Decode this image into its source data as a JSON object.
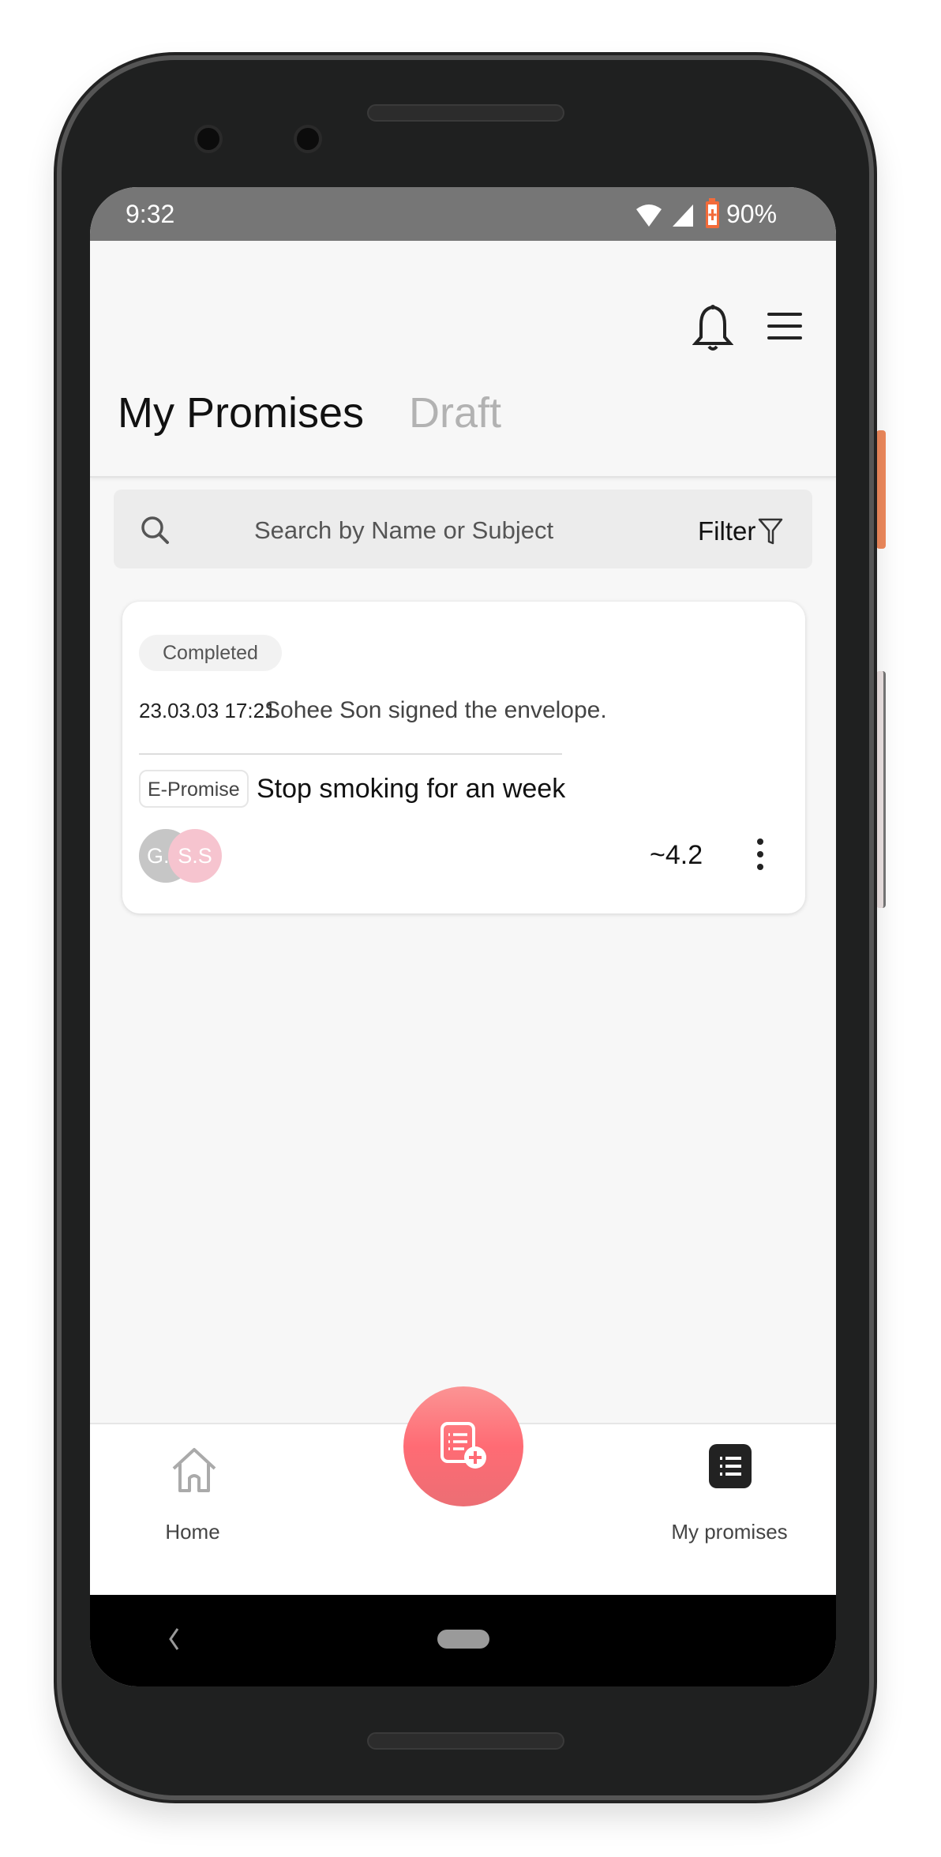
{
  "status_bar": {
    "time": "9:32",
    "battery": "90%",
    "icons": [
      "wifi-icon",
      "signal-icon",
      "battery-charging-icon"
    ]
  },
  "header": {
    "icons": [
      "bell-icon",
      "menu-icon"
    ],
    "tabs": [
      {
        "label": "My Promises",
        "active": true
      },
      {
        "label": "Draft",
        "active": false
      }
    ]
  },
  "search": {
    "placeholder": "Search by Name or Subject",
    "filter_label": "Filter"
  },
  "cards": [
    {
      "status": "Completed",
      "timestamp": "23.03.03 17:21",
      "activity": "Sohee Son signed the envelope.",
      "type": "E-Promise",
      "title": "Stop smoking for an week",
      "participants": [
        {
          "initials": "G.H",
          "color": "#c6c6c6"
        },
        {
          "initials": "S.S",
          "color": "#f6c4cf"
        }
      ],
      "date_range": "~4.2"
    }
  ],
  "bottom_nav": {
    "items": [
      {
        "label": "Home",
        "icon": "home-icon"
      },
      {
        "label": "My promises",
        "icon": "list-icon",
        "active": true
      }
    ],
    "fab_icon": "add-document-icon",
    "fab_color": "#f46b70"
  }
}
